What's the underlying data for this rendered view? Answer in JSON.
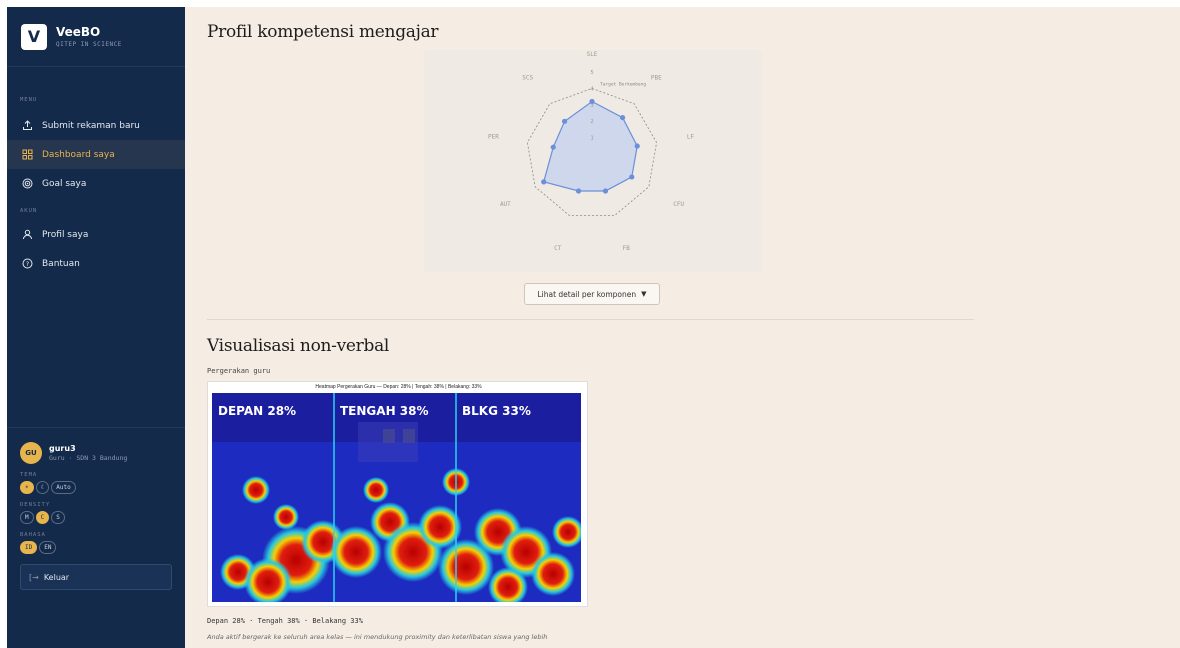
{
  "brand": {
    "logo_letter": "V",
    "name": "VeeBO",
    "subtitle": "QITEP IN SCIENCE"
  },
  "sidebar": {
    "menu_label": "MENU",
    "items": [
      {
        "label": "Submit rekaman baru",
        "icon": "upload-icon",
        "active": false
      },
      {
        "label": "Dashboard saya",
        "icon": "grid-icon",
        "active": true
      },
      {
        "label": "Goal saya",
        "icon": "target-icon",
        "active": false
      }
    ],
    "account_label": "AKUN",
    "account_items": [
      {
        "label": "Profil saya",
        "icon": "user-icon"
      },
      {
        "label": "Bantuan",
        "icon": "help-icon"
      }
    ]
  },
  "user": {
    "initials": "GU",
    "name": "guru3",
    "role": "Guru · SDN 3 Bandung",
    "theme_label": "TEMA",
    "theme_options": [
      "☀",
      "☾",
      "Auto"
    ],
    "density_label": "DENSITY",
    "density_options": [
      "M",
      "C",
      "S"
    ],
    "language_label": "BAHASA",
    "language_options": [
      "ID",
      "EN"
    ],
    "logout_label": "Keluar"
  },
  "main": {
    "radar_title": "Profil kompetensi mengajar",
    "detail_button": "Lihat detail per komponen",
    "nonverbal_title": "Visualisasi non-verbal",
    "movement_label": "Pergerakan guru",
    "heatmap": {
      "caption": "Heatmap Pergerakan Guru — Depan: 28% | Tengah: 38% | Belakang: 33%",
      "zones": [
        {
          "label": "DEPAN 28%",
          "value": 28
        },
        {
          "label": "TENGAH 38%",
          "value": 38
        },
        {
          "label": "BLKG 33%",
          "value": 33
        }
      ]
    },
    "summary": "Depan 28% · Tengah 38% · Belakang 33%",
    "note": "Anda aktif bergerak ke seluruh area kelas — ini mendukung proximity dan keterlibatan siswa yang lebih"
  },
  "chart_data": {
    "type": "radar",
    "axes": [
      "SLE",
      "PBE",
      "LF",
      "CFU",
      "FB",
      "CT",
      "AUT",
      "PER",
      "SCS"
    ],
    "ticks": [
      "1",
      "2",
      "3",
      "4",
      "5"
    ],
    "rmax": 5,
    "series": [
      {
        "values": [
          3.2,
          2.9,
          2.8,
          2.8,
          2.4,
          2.4,
          3.4,
          2.4,
          2.6
        ]
      }
    ],
    "target": {
      "name": "Target Berkembang",
      "values": [
        4,
        4,
        4,
        4,
        4,
        4,
        4,
        4,
        4
      ]
    },
    "colors": {
      "fill": "#c8d4ec",
      "stroke": "#6b8fd8",
      "target": "#8a8a8a"
    }
  }
}
